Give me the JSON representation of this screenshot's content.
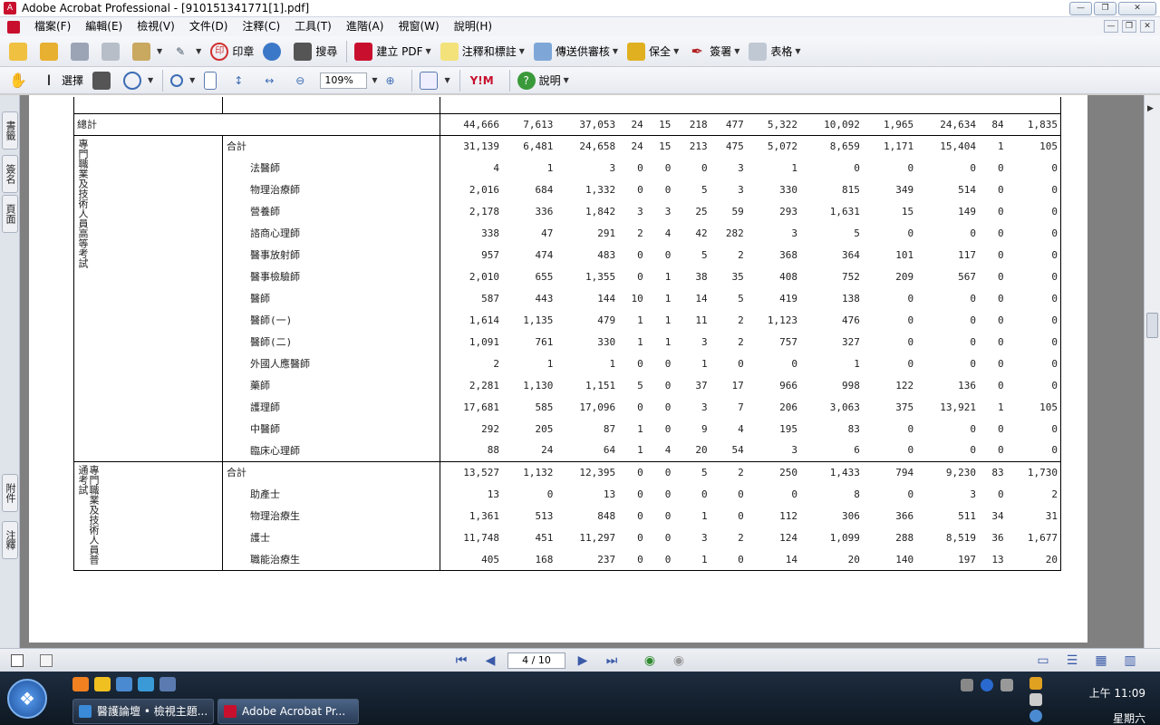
{
  "window": {
    "title": "Adobe Acrobat Professional - [910151341771[1].pdf]",
    "minimize_glyph": "—",
    "maximize_glyph": "❐",
    "close_glyph": "✕"
  },
  "menu": [
    "檔案(F)",
    "編輯(E)",
    "檢視(V)",
    "文件(D)",
    "注釋(C)",
    "工具(T)",
    "進階(A)",
    "視窗(W)",
    "說明(H)"
  ],
  "toolbar1": {
    "stamp_label": "印章",
    "search_label": "搜尋",
    "create_pdf_label": "建立 PDF",
    "comment_label": "注釋和標註",
    "review_label": "傳送供審核",
    "secure_label": "保全",
    "sign_label": "簽署",
    "forms_label": "表格"
  },
  "toolbar2": {
    "select_label": "選擇",
    "zoom_value": "109%",
    "help_label": "說明"
  },
  "side_tabs": [
    "書籤",
    "簽名",
    "頁面",
    "附件",
    "注釋"
  ],
  "table": {
    "total_row": {
      "label": "總計",
      "values": [
        "44,666",
        "7,613",
        "37,053",
        "24",
        "15",
        "218",
        "477",
        "5,322",
        "10,092",
        "1,965",
        "24,634",
        "84",
        "1,835"
      ]
    },
    "groups": [
      {
        "group_label": "專門職業及技術人員高等考試",
        "rows": [
          {
            "label": "合計",
            "indent": false,
            "values": [
              "31,139",
              "6,481",
              "24,658",
              "24",
              "15",
              "213",
              "475",
              "5,072",
              "8,659",
              "1,171",
              "15,404",
              "1",
              "105"
            ]
          },
          {
            "label": "法醫師",
            "indent": true,
            "values": [
              "4",
              "1",
              "3",
              "0",
              "0",
              "0",
              "3",
              "1",
              "0",
              "0",
              "0",
              "0",
              "0"
            ]
          },
          {
            "label": "物理治療師",
            "indent": true,
            "values": [
              "2,016",
              "684",
              "1,332",
              "0",
              "0",
              "5",
              "3",
              "330",
              "815",
              "349",
              "514",
              "0",
              "0"
            ]
          },
          {
            "label": "營養師",
            "indent": true,
            "values": [
              "2,178",
              "336",
              "1,842",
              "3",
              "3",
              "25",
              "59",
              "293",
              "1,631",
              "15",
              "149",
              "0",
              "0"
            ]
          },
          {
            "label": "諮商心理師",
            "indent": true,
            "values": [
              "338",
              "47",
              "291",
              "2",
              "4",
              "42",
              "282",
              "3",
              "5",
              "0",
              "0",
              "0",
              "0"
            ]
          },
          {
            "label": "醫事放射師",
            "indent": true,
            "values": [
              "957",
              "474",
              "483",
              "0",
              "0",
              "5",
              "2",
              "368",
              "364",
              "101",
              "117",
              "0",
              "0"
            ]
          },
          {
            "label": "醫事檢驗師",
            "indent": true,
            "values": [
              "2,010",
              "655",
              "1,355",
              "0",
              "1",
              "38",
              "35",
              "408",
              "752",
              "209",
              "567",
              "0",
              "0"
            ]
          },
          {
            "label": "醫師",
            "indent": true,
            "values": [
              "587",
              "443",
              "144",
              "10",
              "1",
              "14",
              "5",
              "419",
              "138",
              "0",
              "0",
              "0",
              "0"
            ]
          },
          {
            "label": "醫師(一)",
            "indent": true,
            "values": [
              "1,614",
              "1,135",
              "479",
              "1",
              "1",
              "11",
              "2",
              "1,123",
              "476",
              "0",
              "0",
              "0",
              "0"
            ]
          },
          {
            "label": "醫師(二)",
            "indent": true,
            "values": [
              "1,091",
              "761",
              "330",
              "1",
              "1",
              "3",
              "2",
              "757",
              "327",
              "0",
              "0",
              "0",
              "0"
            ]
          },
          {
            "label": "外國人應醫師",
            "indent": true,
            "values": [
              "2",
              "1",
              "1",
              "0",
              "0",
              "1",
              "0",
              "0",
              "1",
              "0",
              "0",
              "0",
              "0"
            ]
          },
          {
            "label": "藥師",
            "indent": true,
            "values": [
              "2,281",
              "1,130",
              "1,151",
              "5",
              "0",
              "37",
              "17",
              "966",
              "998",
              "122",
              "136",
              "0",
              "0"
            ]
          },
          {
            "label": "護理師",
            "indent": true,
            "values": [
              "17,681",
              "585",
              "17,096",
              "0",
              "0",
              "3",
              "7",
              "206",
              "3,063",
              "375",
              "13,921",
              "1",
              "105"
            ]
          },
          {
            "label": "中醫師",
            "indent": true,
            "values": [
              "292",
              "205",
              "87",
              "1",
              "0",
              "9",
              "4",
              "195",
              "83",
              "0",
              "0",
              "0",
              "0"
            ]
          },
          {
            "label": "臨床心理師",
            "indent": true,
            "values": [
              "88",
              "24",
              "64",
              "1",
              "4",
              "20",
              "54",
              "3",
              "6",
              "0",
              "0",
              "0",
              "0"
            ]
          }
        ]
      },
      {
        "group_label": "專門職業及技術人員普通考試",
        "rows": [
          {
            "label": "合計",
            "indent": false,
            "values": [
              "13,527",
              "1,132",
              "12,395",
              "0",
              "0",
              "5",
              "2",
              "250",
              "1,433",
              "794",
              "9,230",
              "83",
              "1,730"
            ]
          },
          {
            "label": "助產士",
            "indent": true,
            "values": [
              "13",
              "0",
              "13",
              "0",
              "0",
              "0",
              "0",
              "0",
              "8",
              "0",
              "3",
              "0",
              "2"
            ]
          },
          {
            "label": "物理治療生",
            "indent": true,
            "values": [
              "1,361",
              "513",
              "848",
              "0",
              "0",
              "1",
              "0",
              "112",
              "306",
              "366",
              "511",
              "34",
              "31"
            ]
          },
          {
            "label": "護士",
            "indent": true,
            "values": [
              "11,748",
              "451",
              "11,297",
              "0",
              "0",
              "3",
              "2",
              "124",
              "1,099",
              "288",
              "8,519",
              "36",
              "1,677"
            ]
          },
          {
            "label": "職能治療生",
            "indent": true,
            "values": [
              "405",
              "168",
              "237",
              "0",
              "0",
              "1",
              "0",
              "14",
              "20",
              "140",
              "197",
              "13",
              "20"
            ]
          }
        ]
      }
    ]
  },
  "navbar": {
    "page_value": "4 / 10"
  },
  "taskbar": {
    "tasks": [
      "醫護論壇 • 檢視主題...",
      "Adobe Acrobat Pr..."
    ],
    "clock_time": "上午 11:09",
    "clock_day": "星期六"
  },
  "colors": {
    "accent": "#c8102e",
    "taskbar": "#1d2c3f",
    "doc_background": "#808080"
  }
}
